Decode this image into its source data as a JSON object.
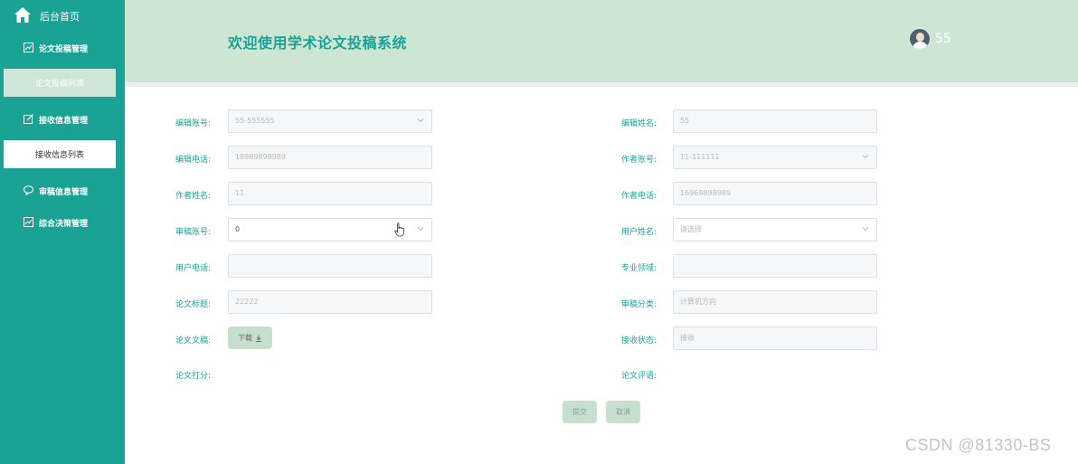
{
  "sidebar": {
    "home_label": "后台首页",
    "groups": [
      {
        "label": "论文投稿管理",
        "icon": "chart-icon"
      },
      {
        "label": "接收信息管理",
        "icon": "edit-icon"
      },
      {
        "label": "审稿信息管理",
        "icon": "message-icon"
      },
      {
        "label": "综合决策管理",
        "icon": "chart-icon"
      }
    ],
    "subitems": [
      {
        "label": "论文投稿列表"
      },
      {
        "label": "接收信息列表"
      }
    ]
  },
  "header": {
    "title": "欢迎使用学术论文投稿系统",
    "username": "55"
  },
  "form": {
    "editor_account": {
      "label": "编辑账号:",
      "value": "55-555555"
    },
    "editor_name": {
      "label": "编辑姓名:",
      "value": "55"
    },
    "editor_phone": {
      "label": "编辑电话:",
      "value": "18989898989"
    },
    "author_account": {
      "label": "作者账号:",
      "value": "11-111111"
    },
    "author_name": {
      "label": "作者姓名:",
      "value": "11"
    },
    "author_phone": {
      "label": "作者电话:",
      "value": "16969898989"
    },
    "review_account": {
      "label": "审稿账号:",
      "value": "0"
    },
    "user_name": {
      "label": "用户姓名:",
      "placeholder": "请选择"
    },
    "user_phone": {
      "label": "用户电话:",
      "value": ""
    },
    "major_field": {
      "label": "专业领域:",
      "value": ""
    },
    "paper_title": {
      "label": "论文标题:",
      "value": "22222"
    },
    "review_category": {
      "label": "审稿分类:",
      "value": "计算机方向"
    },
    "paper_doc": {
      "label": "论文文稿:",
      "download_label": "下载"
    },
    "accept_status": {
      "label": "接收状态:",
      "value": "接收"
    },
    "paper_score": {
      "label": "论文打分:"
    },
    "paper_comment": {
      "label": "论文评语:"
    }
  },
  "actions": {
    "submit_label": "提交",
    "cancel_label": "取消"
  },
  "watermark": "CSDN @81330-BS",
  "colors": {
    "sidebar": "#1aa395",
    "header": "#cde6d3",
    "accent": "#1aa395",
    "button": "#c7dfce"
  }
}
